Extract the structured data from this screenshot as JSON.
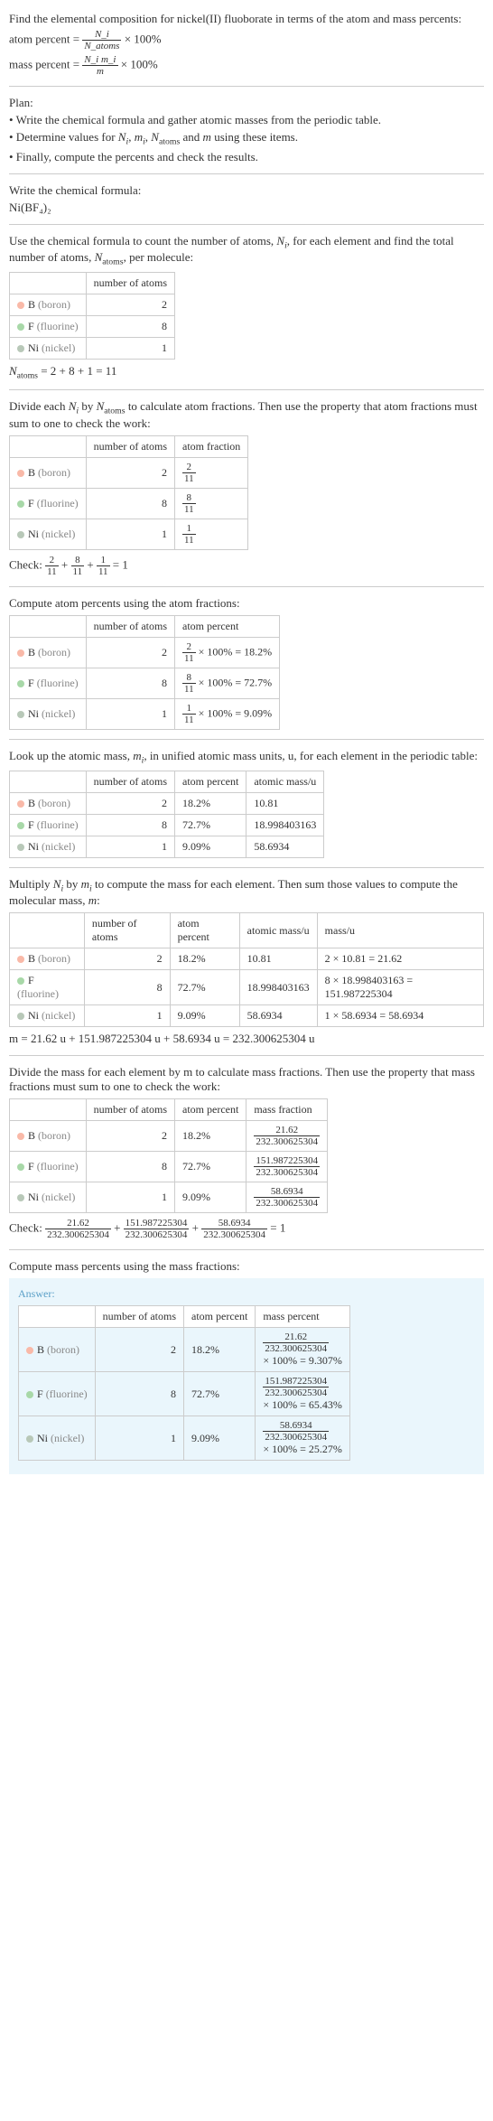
{
  "intro": {
    "title": "Find the elemental composition for nickel(II) fluoborate in terms of the atom and mass percents:",
    "atom_label": "atom percent = ",
    "atom_frac_n": "N_i",
    "atom_frac_d": "N_atoms",
    "times100": " × 100%",
    "mass_label": "mass percent = ",
    "mass_frac_n": "N_i m_i",
    "mass_frac_d": "m"
  },
  "plan": {
    "title": "Plan:",
    "l1": "• Write the chemical formula and gather atomic masses from the periodic table.",
    "l2": "• Determine values for N_i, m_i, N_atoms and m using these items.",
    "l3": "• Finally, compute the percents and check the results."
  },
  "formula": {
    "title": "Write the chemical formula:",
    "value": "Ni(BF₄)₂"
  },
  "countatoms": {
    "title": "Use the chemical formula to count the number of atoms, N_i, for each element and find the total number of atoms, N_atoms, per molecule:",
    "sum": "N_atoms = 2 + 8 + 1 = 11"
  },
  "headers": {
    "natoms": "number of atoms",
    "afrac": "atom fraction",
    "apct": "atom percent",
    "amass": "atomic mass/u",
    "mass": "mass/u",
    "mfrac": "mass fraction",
    "mpct": "mass percent"
  },
  "elements": {
    "b": {
      "sym": "B",
      "name": "(boron)",
      "n": "2"
    },
    "f": {
      "sym": "F",
      "name": "(fluorine)",
      "n": "8"
    },
    "ni": {
      "sym": "Ni",
      "name": "(nickel)",
      "n": "1"
    }
  },
  "atomfrac": {
    "title": "Divide each N_i by N_atoms to calculate atom fractions. Then use the property that atom fractions must sum to one to check the work:",
    "b_n": "2",
    "b_d": "11",
    "f_n": "8",
    "f_d": "11",
    "ni_n": "1",
    "ni_d": "11",
    "check": "Check: ",
    "eq": " = 1"
  },
  "atompct": {
    "title": "Compute atom percents using the atom fractions:",
    "b": " × 100% = 18.2%",
    "f": " × 100% = 72.7%",
    "ni": " × 100% = 9.09%",
    "bv": "18.2%",
    "fv": "72.7%",
    "niv": "9.09%"
  },
  "atomicmass": {
    "title": "Look up the atomic mass, m_i, in unified atomic mass units, u, for each element in the periodic table:",
    "b": "10.81",
    "f": "18.998403163",
    "ni": "58.6934"
  },
  "molmass": {
    "title": "Multiply N_i by m_i to compute the mass for each element. Then sum those values to compute the molecular mass, m:",
    "b": "2 × 10.81 = 21.62",
    "f": "8 × 18.998403163 = 151.987225304",
    "ni": "1 × 58.6934 = 58.6934",
    "sum": "m = 21.62 u + 151.987225304 u + 58.6934 u = 232.300625304 u"
  },
  "massfrac": {
    "title": "Divide the mass for each element by m to calculate mass fractions. Then use the property that mass fractions must sum to one to check the work:",
    "b_n": "21.62",
    "b_d": "232.300625304",
    "f_n": "151.987225304",
    "f_d": "232.300625304",
    "ni_n": "58.6934",
    "ni_d": "232.300625304",
    "check": "Check: ",
    "eq": " = 1",
    "plus": " + "
  },
  "masspct": {
    "title": "Compute mass percents using the mass fractions:",
    "answer": "Answer:",
    "b1": "21.62",
    "b2": "232.300625304",
    "b3": "× 100% = 9.307%",
    "f1": "151.987225304",
    "f2": "232.300625304",
    "f3": "× 100% = 65.43%",
    "ni1": "58.6934",
    "ni2": "232.300625304",
    "ni3": "× 100% = 25.27%"
  }
}
